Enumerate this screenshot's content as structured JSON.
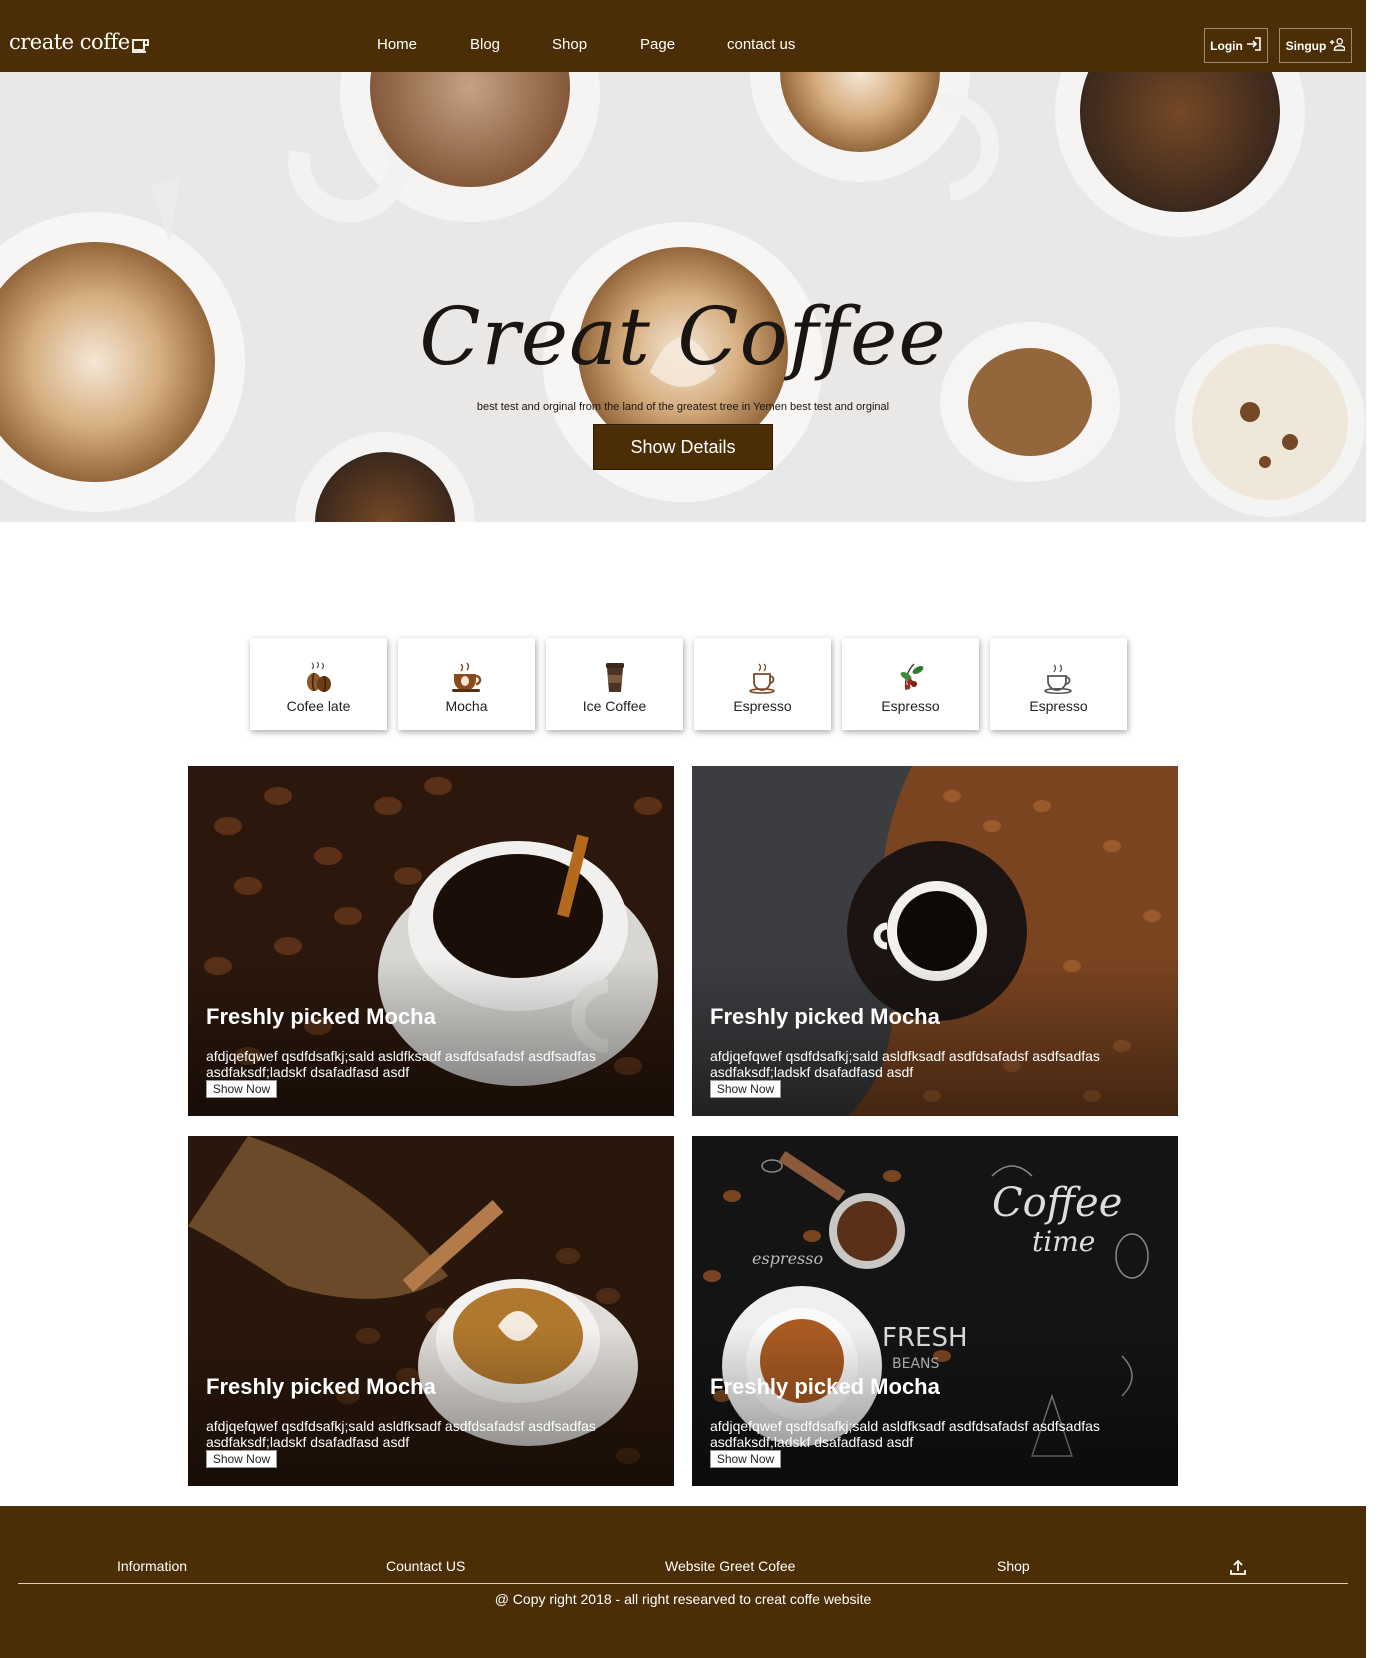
{
  "navbar": {
    "brand": "create coffe",
    "brand_icon": "coffee-cup-icon",
    "links": [
      "Home",
      "Blog",
      "Shop",
      "Page",
      "contact us"
    ],
    "login_label": "Login",
    "login_icon": "login-arrow-icon",
    "signup_label": "Singup",
    "signup_icon": "add-user-icon"
  },
  "hero": {
    "title": "Creat Coffee",
    "subtitle": "best test and orginal from the land of the greatest tree in Yemen best test and orginal",
    "button_label": "Show Details"
  },
  "categories": [
    {
      "label": "Cofee late",
      "icon": "coffee-beans-icon"
    },
    {
      "label": "Mocha",
      "icon": "coffee-cup-bean-icon"
    },
    {
      "label": "Ice Coffee",
      "icon": "takeaway-cup-icon"
    },
    {
      "label": "Espresso",
      "icon": "espresso-cup-icon"
    },
    {
      "label": "Espresso",
      "icon": "coffee-plant-icon"
    },
    {
      "label": "Espresso",
      "icon": "steaming-cup-icon"
    }
  ],
  "products": [
    {
      "title": "Freshly picked Mocha",
      "description": "afdjqefqwef qsdfdsafkj;sald asldfksadf asdfdsafadsf asdfsadfas asdfaksdf;ladskf dsafadfasd asdf",
      "button_label": "Show Now"
    },
    {
      "title": "Freshly picked Mocha",
      "description": "afdjqefqwef qsdfdsafkj;sald asldfksadf asdfdsafadsf asdfsadfas asdfaksdf;ladskf dsafadfasd asdf",
      "button_label": "Show Now"
    },
    {
      "title": "Freshly picked Mocha",
      "description": "afdjqefqwef qsdfdsafkj;sald asldfksadf asdfdsafadsf asdfsadfas asdfaksdf;ladskf dsafadfasd asdf",
      "button_label": "Show Now"
    },
    {
      "title": "Freshly picked Mocha",
      "description": "afdjqefqwef qsdfdsafkj;sald asldfksadf asdfdsafadsf asdfsadfas asdfaksdf;ladskf dsafadfasd asdf",
      "button_label": "Show Now"
    }
  ],
  "footer": {
    "links": [
      "Information",
      "Countact US",
      "Website Greet Cofee",
      "Shop"
    ],
    "scroll_top_icon": "upload-arrow-icon",
    "copyright": "@ Copy right 2018 - all right researved to creat coffe website"
  },
  "colors": {
    "brand_brown": "#4b2e05",
    "white": "#ffffff"
  }
}
